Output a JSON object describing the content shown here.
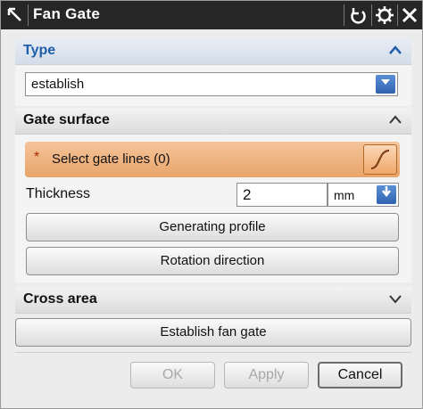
{
  "window": {
    "title": "Fan Gate"
  },
  "type_section": {
    "header": "Type",
    "value": "establish"
  },
  "gate_surface": {
    "header": "Gate surface",
    "select_prompt": "Select gate lines (0)",
    "select_marker": "*",
    "thickness_label": "Thickness",
    "thickness_value": "2",
    "thickness_unit": "mm",
    "generating_profile": "Generating profile",
    "rotation_direction": "Rotation direction"
  },
  "cross_area": {
    "header": "Cross area"
  },
  "actions": {
    "establish": "Establish fan gate",
    "ok": "OK",
    "apply": "Apply",
    "cancel": "Cancel"
  },
  "colors": {
    "titlebar": "#262626",
    "type_header_text": "#1f5faa",
    "selection_highlight": "#e9a46a",
    "dropdown_accent": "#2f63b0"
  },
  "icons": {
    "titlebar_left": "arrow-icon",
    "reset": "reset-icon",
    "settings": "gear-icon",
    "close": "close-icon",
    "curve": "curve-icon"
  }
}
